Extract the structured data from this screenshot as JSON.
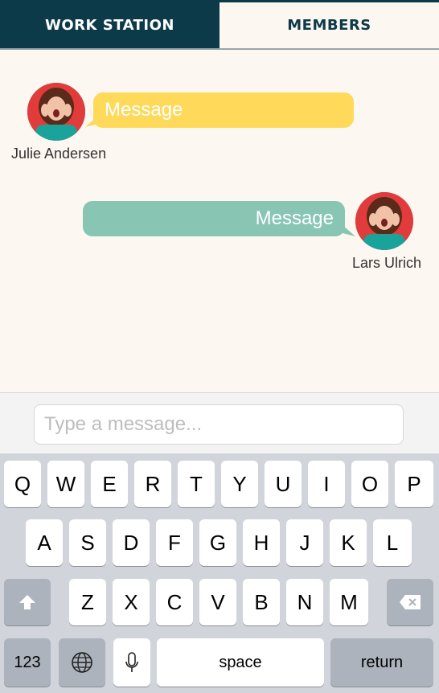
{
  "tabs": [
    {
      "label": "WORK STATION",
      "active": true
    },
    {
      "label": "MEMBERS",
      "active": false
    }
  ],
  "messages": [
    {
      "sender": "Julie Andersen",
      "text": "Message",
      "side": "left",
      "bubble_color": "#ffd95a"
    },
    {
      "sender": "Lars Ulrich",
      "text": "Message",
      "side": "right",
      "bubble_color": "#88c6b3"
    }
  ],
  "composer": {
    "placeholder": "Type a message..."
  },
  "keyboard": {
    "row1": [
      "Q",
      "W",
      "E",
      "R",
      "T",
      "Y",
      "U",
      "I",
      "O",
      "P"
    ],
    "row2": [
      "A",
      "S",
      "D",
      "F",
      "G",
      "H",
      "J",
      "K",
      "L"
    ],
    "row3": [
      "Z",
      "X",
      "C",
      "V",
      "B",
      "N",
      "M"
    ],
    "shift_icon": "shift-icon",
    "backspace_icon": "backspace-icon",
    "numbers_label": "123",
    "globe_icon": "globe-icon",
    "mic_icon": "microphone-icon",
    "space_label": "space",
    "return_label": "return"
  },
  "colors": {
    "header": "#0d3a49",
    "background": "#fdf7f1"
  }
}
